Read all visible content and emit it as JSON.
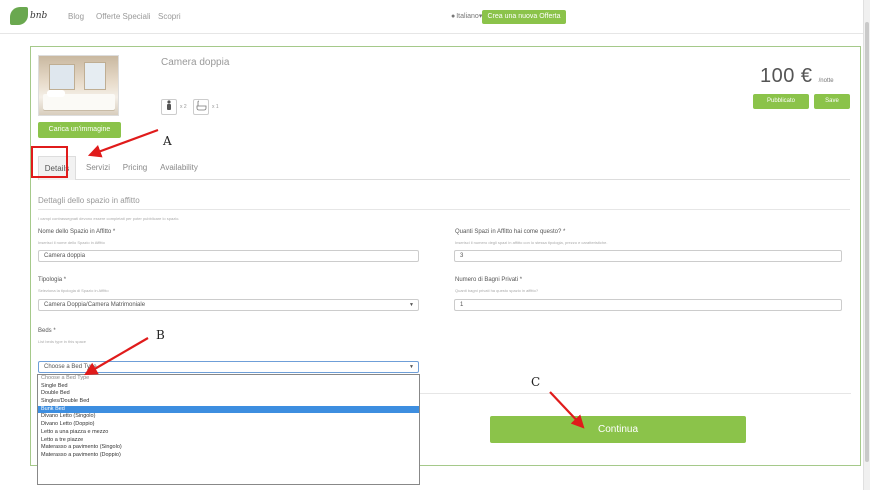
{
  "nav": {
    "logo_text": "bnb",
    "links": [
      "Blog",
      "Offerte Speciali",
      "Scopri"
    ],
    "language": "Italiano",
    "language_caret": "▾",
    "create_offer": "Crea una nuova Offerta"
  },
  "room": {
    "title": "Camera doppia",
    "upload_image": "Carica un'immagine",
    "guests": "x 2",
    "bathrooms": "x 1",
    "price": "100 €",
    "price_unit": "/notte",
    "published": "Pubblicato",
    "save": "Save"
  },
  "tabs": [
    "Details",
    "Servizi",
    "Pricing",
    "Availability"
  ],
  "details": {
    "section_title": "Dettagli dello spazio in affitto",
    "required_note": "I campi contrassegnati devono essere completati per poter pubblicare lo spazio.",
    "name_label": "Nome dello Spazio in Affitto *",
    "name_help": "Inserisci il nome dello Spazio in Affitto",
    "name_value": "Camera doppia",
    "count_label": "Quanti Spazi in Affitto hai come questo? *",
    "count_help": "Inserisci il numero degli spazi in affitto con lo stessa tipologia, prezzo e caratteristiche.",
    "count_value": "3",
    "type_label": "Tipologia *",
    "type_help": "Seleziona la tipologia di Spazio in Affitto",
    "type_value": "Camera Doppia/Camera Matrimoniale",
    "baths_label": "Numero di Bagni Privati *",
    "baths_help": "Quanti bagni privati ha questo spazio in affitto?",
    "baths_value": "1",
    "beds_label": "Beds *",
    "beds_help": "List beds type in this space",
    "beds_value": "Choose a Bed Type"
  },
  "bed_options": [
    "Choose a Bed Type",
    "Single Bed",
    "Double Bed",
    "Singles/Double Bed",
    "Bunk Bed",
    "Divano Letto (Singolo)",
    "Divano Letto (Doppio)",
    "Letto a una piazza e mezzo",
    "Letto a tre piazze",
    "Materasso a pavimento (Singolo)",
    "Materasso a pavimento (Doppio)"
  ],
  "bed_selected_index": 4,
  "continue": "Continua",
  "annotations": {
    "a": "A",
    "b": "B",
    "c": "C"
  },
  "colors": {
    "accent": "#8bc34a",
    "annotation": "#e01b1b",
    "selection": "#3d8ee0"
  }
}
